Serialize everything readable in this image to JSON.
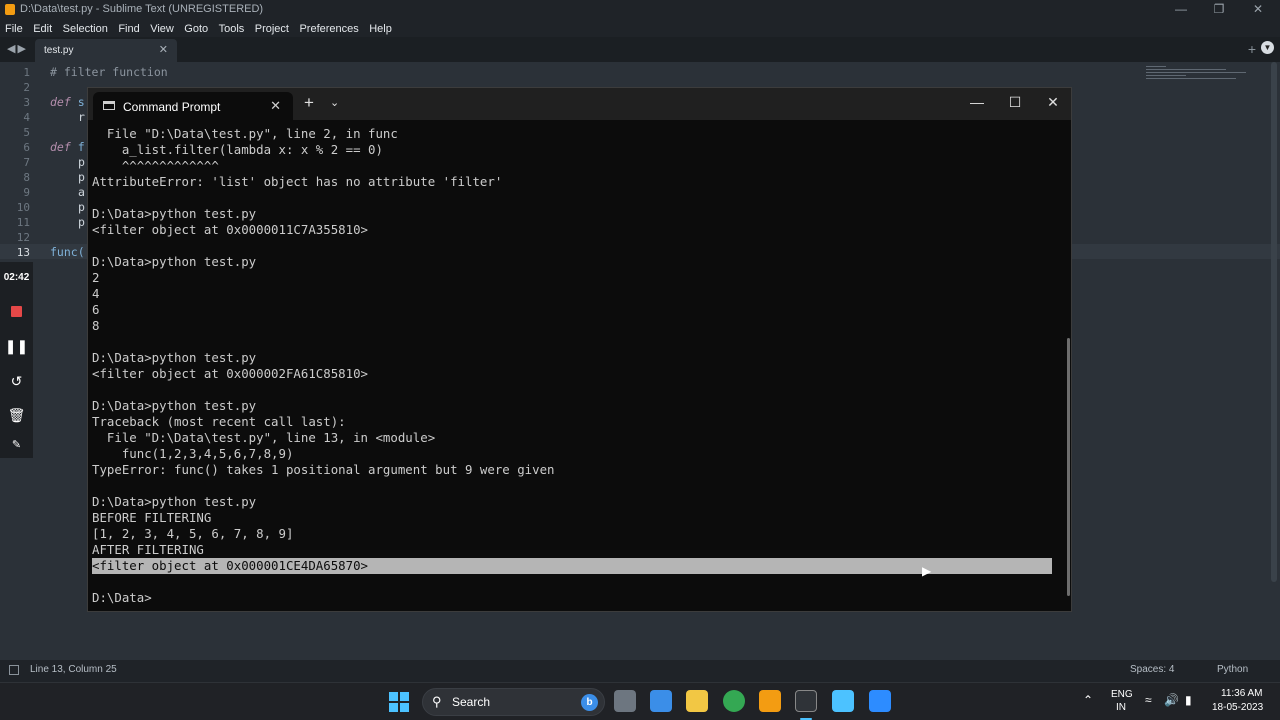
{
  "sublime": {
    "title": "D:\\Data\\test.py - Sublime Text (UNREGISTERED)",
    "menu": [
      "File",
      "Edit",
      "Selection",
      "Find",
      "View",
      "Goto",
      "Tools",
      "Project",
      "Preferences",
      "Help"
    ],
    "tab_label": "test.py",
    "line_numbers": [
      "1",
      "2",
      "3",
      "4",
      "5",
      "6",
      "7",
      "8",
      "9",
      "10",
      "11",
      "12",
      "13"
    ],
    "current_line": "13",
    "code_fragments": {
      "l1": "# filter function",
      "l3_kw": "def",
      "l3_rest": " s",
      "l4": "r",
      "l6_kw": "def",
      "l6_rest": " f",
      "l7": "p",
      "l8": "p",
      "l9": "a",
      "l10": "p",
      "l11": "p",
      "l13": "func("
    },
    "status": {
      "position": "Line 13, Column 25",
      "spaces": "Spaces: 4",
      "syntax": "Python"
    }
  },
  "recorder": {
    "time": "02:42"
  },
  "cmd": {
    "tab_title": "Command Prompt",
    "lines": [
      "  File \"D:\\Data\\test.py\", line 2, in func",
      "    a_list.filter(lambda x: x % 2 == 0)",
      "    ^^^^^^^^^^^^^",
      "AttributeError: 'list' object has no attribute 'filter'",
      "",
      "D:\\Data>python test.py",
      "<filter object at 0x0000011C7A355810>",
      "",
      "D:\\Data>python test.py",
      "2",
      "4",
      "6",
      "8",
      "",
      "D:\\Data>python test.py",
      "<filter object at 0x000002FA61C85810>",
      "",
      "D:\\Data>python test.py",
      "Traceback (most recent call last):",
      "  File \"D:\\Data\\test.py\", line 13, in <module>",
      "    func(1,2,3,4,5,6,7,8,9)",
      "TypeError: func() takes 1 positional argument but 9 were given",
      "",
      "D:\\Data>python test.py",
      "BEFORE FILTERING",
      "[1, 2, 3, 4, 5, 6, 7, 8, 9]",
      "AFTER FILTERING",
      "<filter object at 0x000001CE4DA65870>",
      "",
      "D:\\Data>"
    ],
    "selected_line_index": 27
  },
  "taskbar": {
    "search_label": "Search",
    "language": "ENG",
    "region": "IN",
    "time": "11:36 AM",
    "date": "18-05-2023"
  },
  "icons": {
    "colors": {
      "file_explorer": "#f2c744",
      "chrome": "#34a853",
      "sublime": "#f39c12",
      "notepad": "#4cc2ff",
      "zoom": "#2d8cff",
      "store": "#3b8ee8"
    }
  }
}
